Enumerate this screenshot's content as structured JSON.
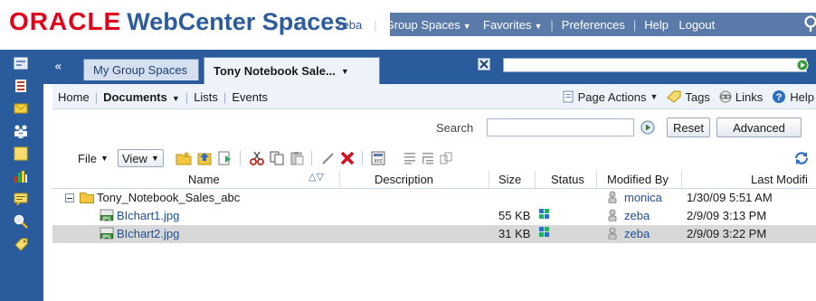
{
  "brand": {
    "oracle": "ORACLE",
    "product": "WebCenter Spaces"
  },
  "top_nav": {
    "user": "zeba",
    "items": [
      {
        "label": "Group Spaces",
        "dropdown": true
      },
      {
        "label": "Favorites",
        "dropdown": true
      },
      {
        "label": "Preferences",
        "dropdown": false
      },
      {
        "label": "Help",
        "dropdown": false
      },
      {
        "label": "Logout",
        "dropdown": false
      }
    ],
    "search_icon": "search-icon"
  },
  "rail": {
    "icons": [
      "home-icon",
      "lists-icon",
      "mail-icon",
      "people-icon",
      "notes-icon",
      "analytics-icon",
      "discussions-icon",
      "search-icon",
      "tags-icon"
    ]
  },
  "tabs": {
    "collapse_glyph": "«",
    "items": [
      {
        "label": "My Group Spaces",
        "active": false
      },
      {
        "label": "Tony Notebook Sale...",
        "active": true
      }
    ]
  },
  "subnav": {
    "links": [
      {
        "label": "Home",
        "current": false,
        "dropdown": false
      },
      {
        "label": "Documents",
        "current": true,
        "dropdown": true
      },
      {
        "label": "Lists",
        "current": false,
        "dropdown": false
      },
      {
        "label": "Events",
        "current": false,
        "dropdown": false
      }
    ],
    "actions": {
      "page_actions": "Page Actions",
      "tags": "Tags",
      "links": "Links",
      "help": "Help"
    }
  },
  "search": {
    "label": "Search",
    "value": "",
    "reset": "Reset",
    "advanced": "Advanced"
  },
  "toolbar": {
    "file": "File",
    "view": "View",
    "tools": [
      "new-folder-icon",
      "upload-icon",
      "download-icon",
      "cut-icon",
      "copy-icon",
      "paste-icon",
      "edit-icon",
      "delete-icon",
      "properties-icon",
      "checkout-icon",
      "checkin-icon",
      "move-icon"
    ],
    "refresh": "refresh-icon"
  },
  "table": {
    "headers": {
      "name": "Name",
      "description": "Description",
      "size": "Size",
      "status": "Status",
      "modified_by": "Modified By",
      "last_modified": "Last Modifi"
    },
    "folder": {
      "name": "Tony_Notebook_Sales_abc",
      "modified_by": "monica",
      "last_modified": "1/30/09 5:51 AM"
    },
    "files": [
      {
        "name": "BIchart1.jpg",
        "size": "55 KB",
        "modified_by": "zeba",
        "last_modified": "2/9/09 3:13 PM",
        "selected": false
      },
      {
        "name": "BIchart2.jpg",
        "size": "31 KB",
        "modified_by": "zeba",
        "last_modified": "2/9/09 3:22 PM",
        "selected": true
      }
    ]
  },
  "colors": {
    "brand_red": "#e3001b",
    "brand_blue": "#2d5c9c",
    "chrome_blue": "#2a5b9c",
    "selected_row": "#d8d8d8"
  }
}
